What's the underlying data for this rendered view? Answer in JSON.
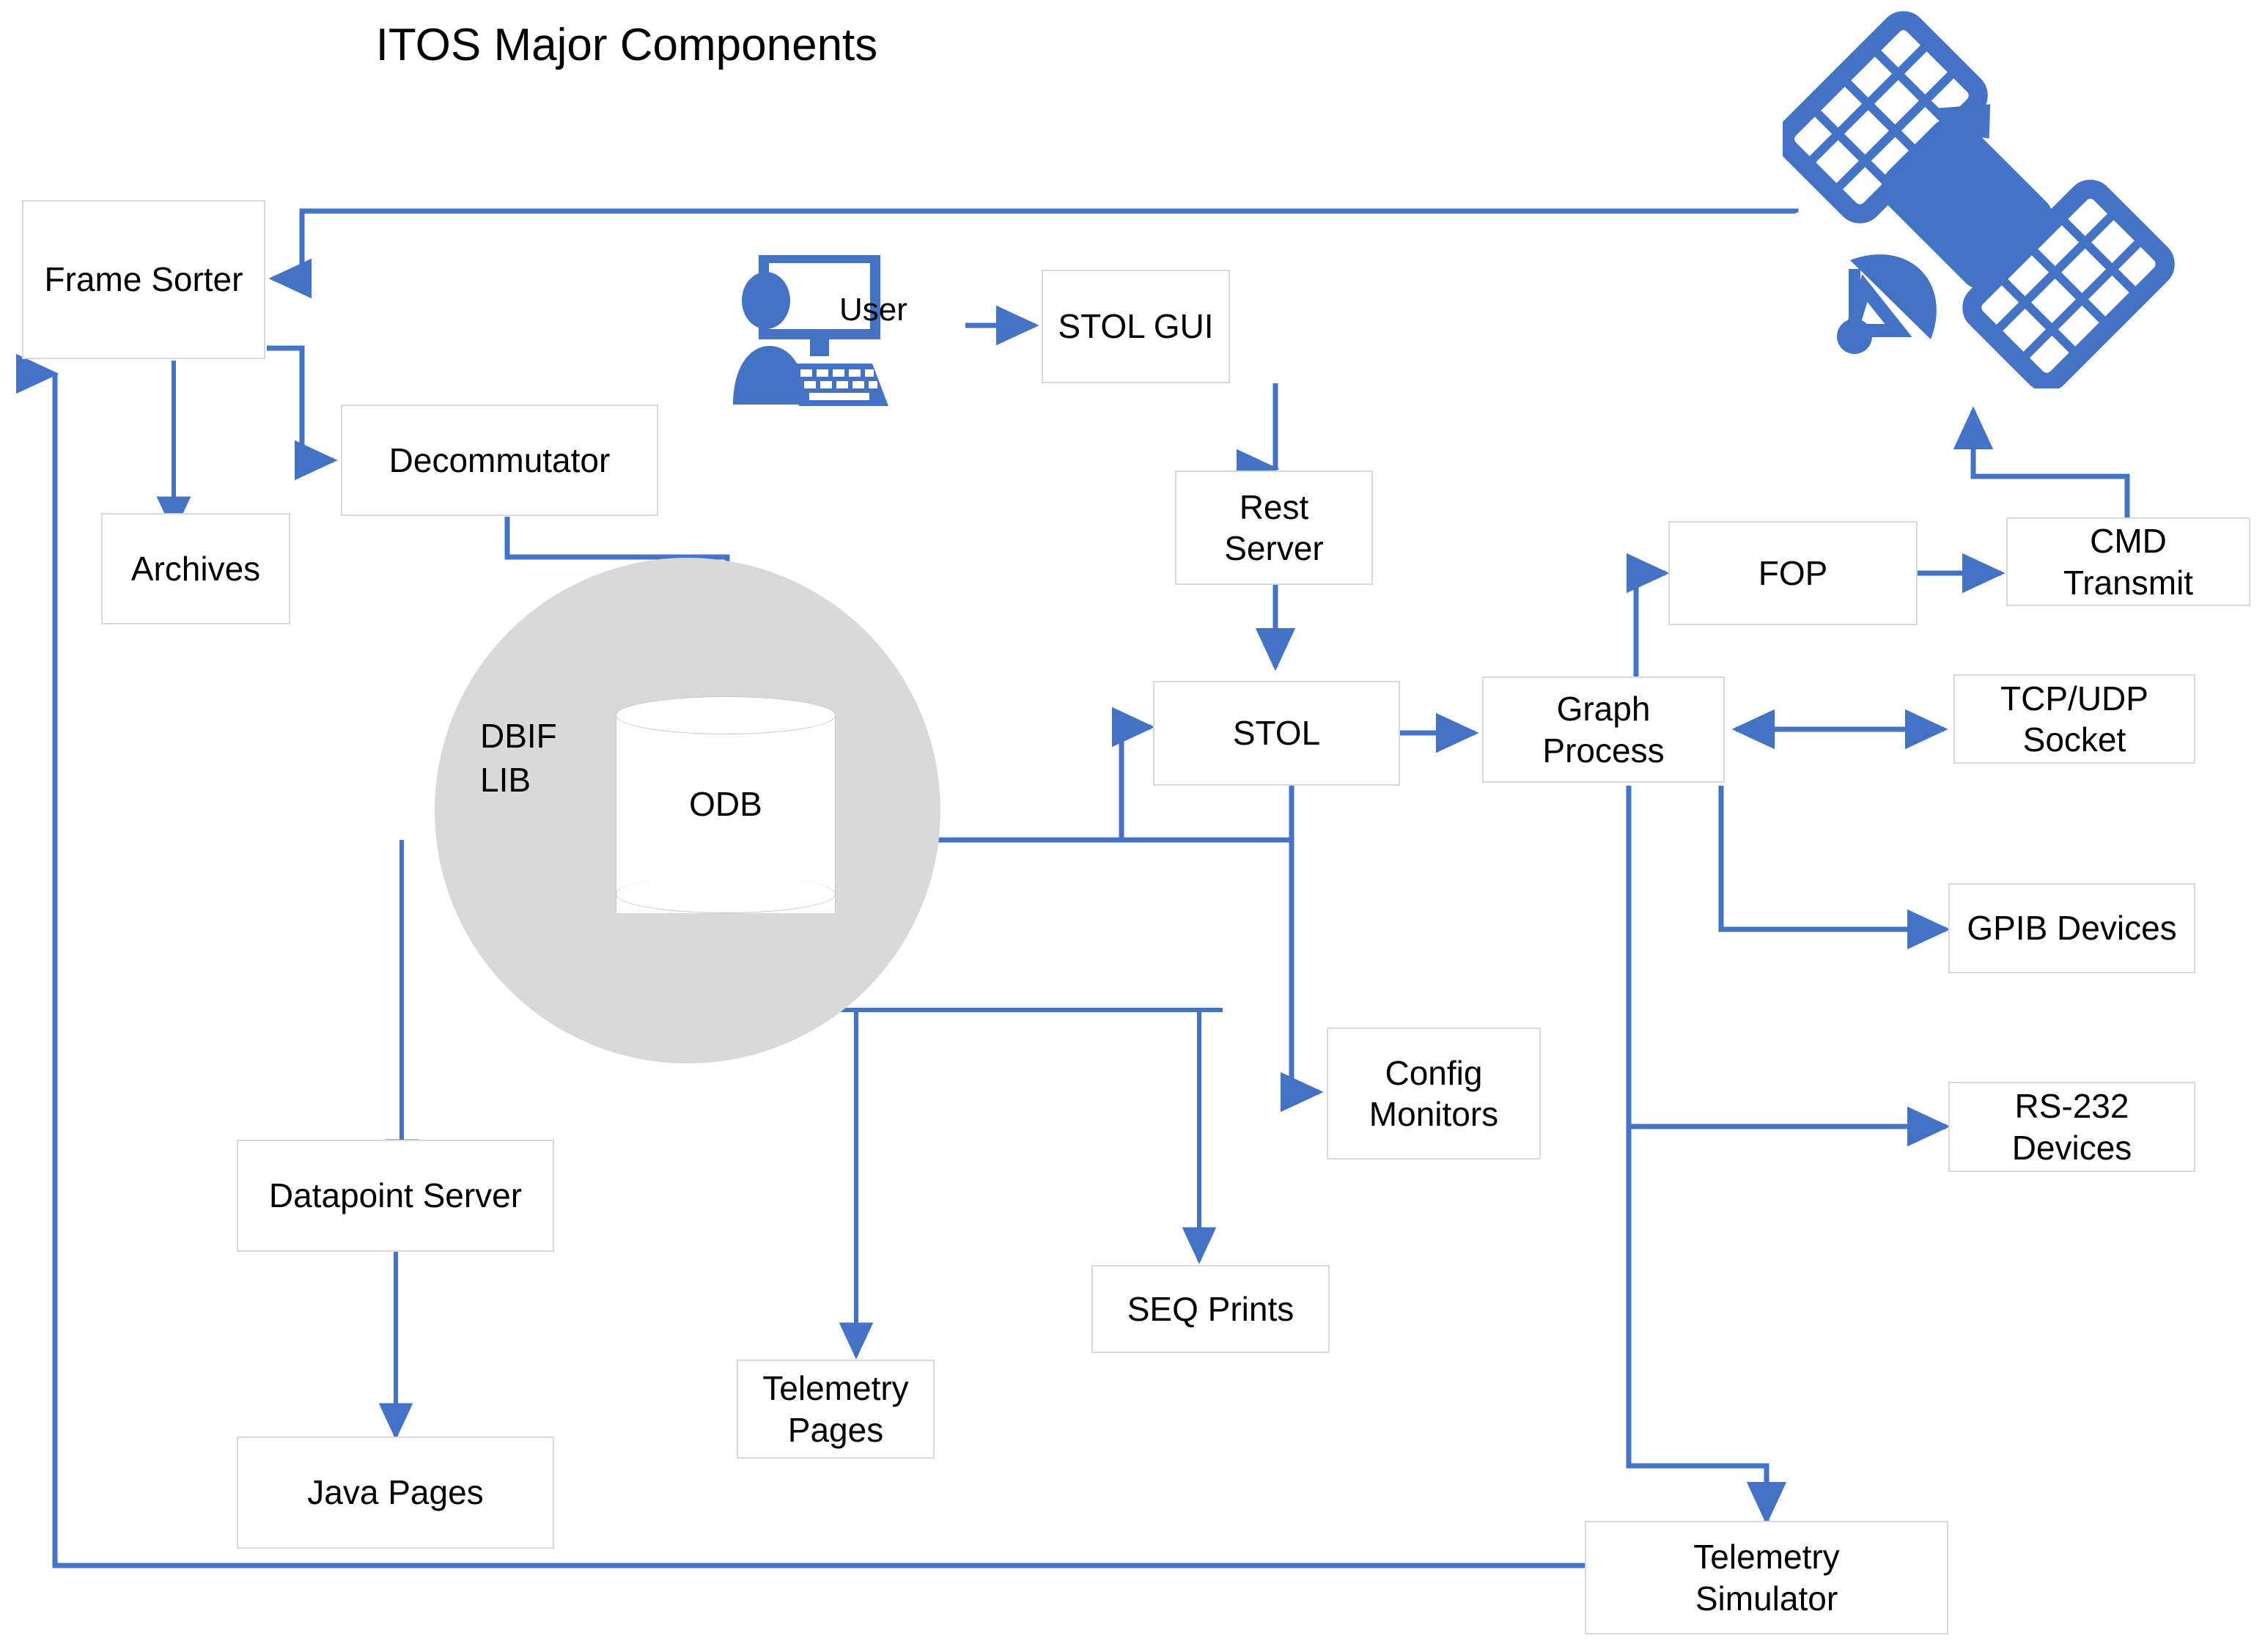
{
  "title": "ITOS Major Components",
  "colors": {
    "arrow": "#4472C4",
    "node_border": "#D9D9D9",
    "node_fill": "#FFFFFF",
    "group_fill": "#D9D9D9",
    "icon": "#4472C4",
    "text": "#000000"
  },
  "group": {
    "dbif_label": "DBIF\nLIB"
  },
  "datastore": {
    "odb_label": "ODB"
  },
  "icons": {
    "user_label": "User",
    "user_icon_name": "user-at-computer-icon",
    "satellite_icon_name": "satellite-icon"
  },
  "nodes": [
    {
      "id": "frame-sorter",
      "label": "Frame Sorter"
    },
    {
      "id": "archives",
      "label": "Archives"
    },
    {
      "id": "decommutator",
      "label": "Decommutator"
    },
    {
      "id": "stol-gui",
      "label": "STOL GUI"
    },
    {
      "id": "rest-server",
      "label": "Rest\nServer"
    },
    {
      "id": "stol",
      "label": "STOL"
    },
    {
      "id": "graph-process",
      "label": "Graph\nProcess"
    },
    {
      "id": "fop",
      "label": "FOP"
    },
    {
      "id": "cmd-transmit",
      "label": "CMD\nTransmit"
    },
    {
      "id": "tcp-udp-socket",
      "label": "TCP/UDP\nSocket"
    },
    {
      "id": "gpib-devices",
      "label": "GPIB Devices"
    },
    {
      "id": "rs232-devices",
      "label": "RS-232\nDevices"
    },
    {
      "id": "config-monitors",
      "label": "Config\nMonitors"
    },
    {
      "id": "seq-prints",
      "label": "SEQ Prints"
    },
    {
      "id": "telemetry-pages",
      "label": "Telemetry\nPages"
    },
    {
      "id": "datapoint-server",
      "label": "Datapoint Server"
    },
    {
      "id": "java-pages",
      "label": "Java Pages"
    },
    {
      "id": "telemetry-simulator",
      "label": "Telemetry\nSimulator"
    }
  ],
  "chart_data": {
    "type": "diagram",
    "title": "ITOS Major Components",
    "nodes": [
      "Frame Sorter",
      "Archives",
      "Decommutator",
      "ODB",
      "DBIF LIB",
      "User",
      "STOL GUI",
      "Rest Server",
      "STOL",
      "Graph Process",
      "FOP",
      "CMD Transmit",
      "TCP/UDP Socket",
      "GPIB Devices",
      "RS-232 Devices",
      "Config Monitors",
      "SEQ Prints",
      "Telemetry Pages",
      "Datapoint Server",
      "Java Pages",
      "Telemetry Simulator",
      "Satellite"
    ],
    "edges": [
      {
        "from": "Satellite",
        "to": "Frame Sorter",
        "arrow": "single"
      },
      {
        "from": "Frame Sorter",
        "to": "Archives",
        "arrow": "single"
      },
      {
        "from": "Frame Sorter",
        "to": "Decommutator",
        "arrow": "single"
      },
      {
        "from": "Decommutator",
        "to": "ODB",
        "arrow": "single"
      },
      {
        "from": "User",
        "to": "STOL GUI",
        "arrow": "single"
      },
      {
        "from": "STOL GUI",
        "to": "Rest Server",
        "arrow": "single"
      },
      {
        "from": "Rest Server",
        "to": "STOL",
        "arrow": "single"
      },
      {
        "from": "ODB",
        "to": "STOL",
        "arrow": "single"
      },
      {
        "from": "STOL",
        "to": "Graph Process",
        "arrow": "single"
      },
      {
        "from": "STOL",
        "to": "ODB",
        "arrow": "single"
      },
      {
        "from": "STOL",
        "to": "Config Monitors",
        "arrow": "single"
      },
      {
        "from": "Graph Process",
        "to": "FOP",
        "arrow": "single"
      },
      {
        "from": "FOP",
        "to": "CMD Transmit",
        "arrow": "single"
      },
      {
        "from": "CMD Transmit",
        "to": "Satellite",
        "arrow": "single"
      },
      {
        "from": "Graph Process",
        "to": "TCP/UDP Socket",
        "arrow": "double"
      },
      {
        "from": "Graph Process",
        "to": "GPIB Devices",
        "arrow": "single"
      },
      {
        "from": "Graph Process",
        "to": "RS-232 Devices",
        "arrow": "single"
      },
      {
        "from": "Graph Process",
        "to": "Telemetry Simulator",
        "arrow": "single"
      },
      {
        "from": "Telemetry Simulator",
        "to": "Frame Sorter",
        "arrow": "single"
      },
      {
        "from": "ODB",
        "to": "Telemetry Pages",
        "arrow": "single"
      },
      {
        "from": "ODB",
        "to": "SEQ Prints",
        "arrow": "single"
      },
      {
        "from": "ODB",
        "to": "Datapoint Server",
        "arrow": "single"
      },
      {
        "from": "Datapoint Server",
        "to": "Java Pages",
        "arrow": "single"
      }
    ]
  }
}
